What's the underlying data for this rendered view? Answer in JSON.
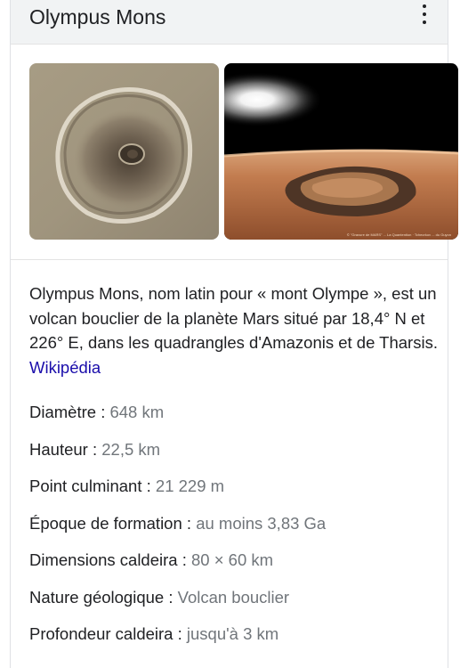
{
  "header": {
    "title": "Olympus Mons",
    "menu_icon": "more-vert-icon"
  },
  "gallery": {
    "images": [
      {
        "name": "olympus-mons-top-view-image"
      },
      {
        "name": "olympus-mons-perspective-image",
        "caption": "© \"Gravure de MARS\" ... La Quantention · Tcheorkov ... du Guyon"
      }
    ]
  },
  "description": {
    "text": "Olympus Mons, nom latin pour « mont Olympe », est un volcan bouclier de la planète Mars situé par 18,4° N et 226° E, dans les quadrangles d'Amazonis et de Tharsis.",
    "source_link": "Wikipédia"
  },
  "facts": [
    {
      "label": "Diamètre",
      "value": "648 km"
    },
    {
      "label": "Hauteur",
      "value": "22,5 km"
    },
    {
      "label": "Point culminant",
      "value": "21 229 m"
    },
    {
      "label": "Époque de formation",
      "value": "au moins 3,83 Ga"
    },
    {
      "label": "Dimensions caldeira",
      "value": "80 × 60 km"
    },
    {
      "label": "Nature géologique",
      "value": "Volcan bouclier"
    },
    {
      "label": "Profondeur caldeira",
      "value": "jusqu'à 3 km"
    }
  ],
  "separator": " : ",
  "colors": {
    "link": "#1a0dab",
    "value_text": "#70757a",
    "header_bg": "#f1f3f4"
  }
}
